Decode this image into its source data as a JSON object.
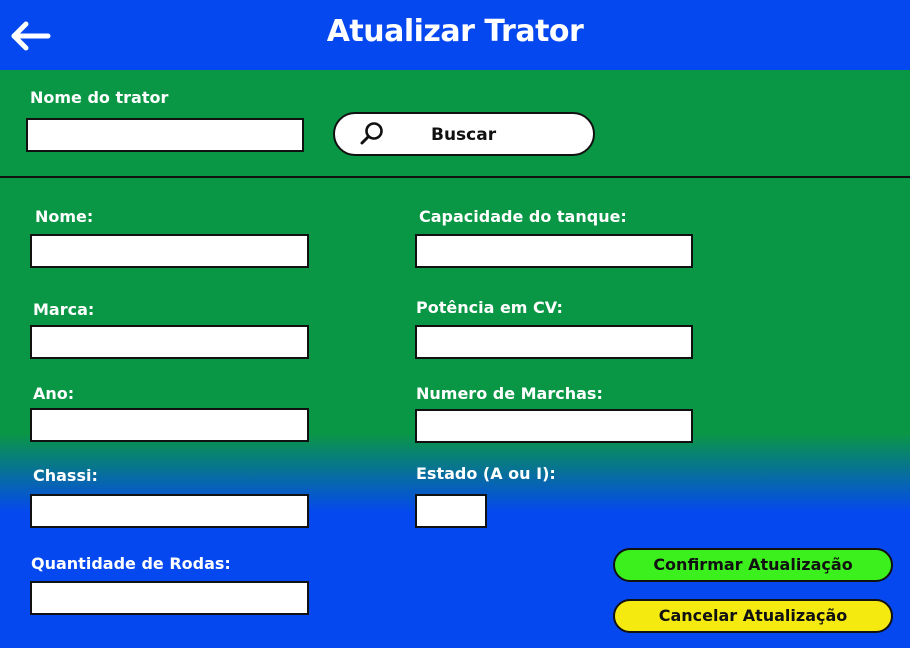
{
  "header": {
    "title": "Atualizar Trator",
    "back_icon": "arrow-left-icon"
  },
  "search": {
    "label": "Nome do trator",
    "value": "",
    "button_label": "Buscar",
    "button_icon": "search-icon"
  },
  "form": {
    "nome_label": "Nome:",
    "marca_label": "Marca:",
    "ano_label": "Ano:",
    "chassi_label": "Chassi:",
    "rodas_label": "Quantidade de Rodas:",
    "tanque_label": "Capacidade do tanque:",
    "potencia_label": "Potência em CV:",
    "marchas_label": "Numero de Marchas:",
    "estado_label": "Estado (A ou I):"
  },
  "actions": {
    "confirm_label": "Confirmar Atualização",
    "cancel_label": "Cancelar Atualização"
  },
  "colors": {
    "header_blue": "#0548f0",
    "form_green": "#0a9745",
    "confirm_green": "#3cf01e",
    "cancel_yellow": "#f5ea10"
  }
}
